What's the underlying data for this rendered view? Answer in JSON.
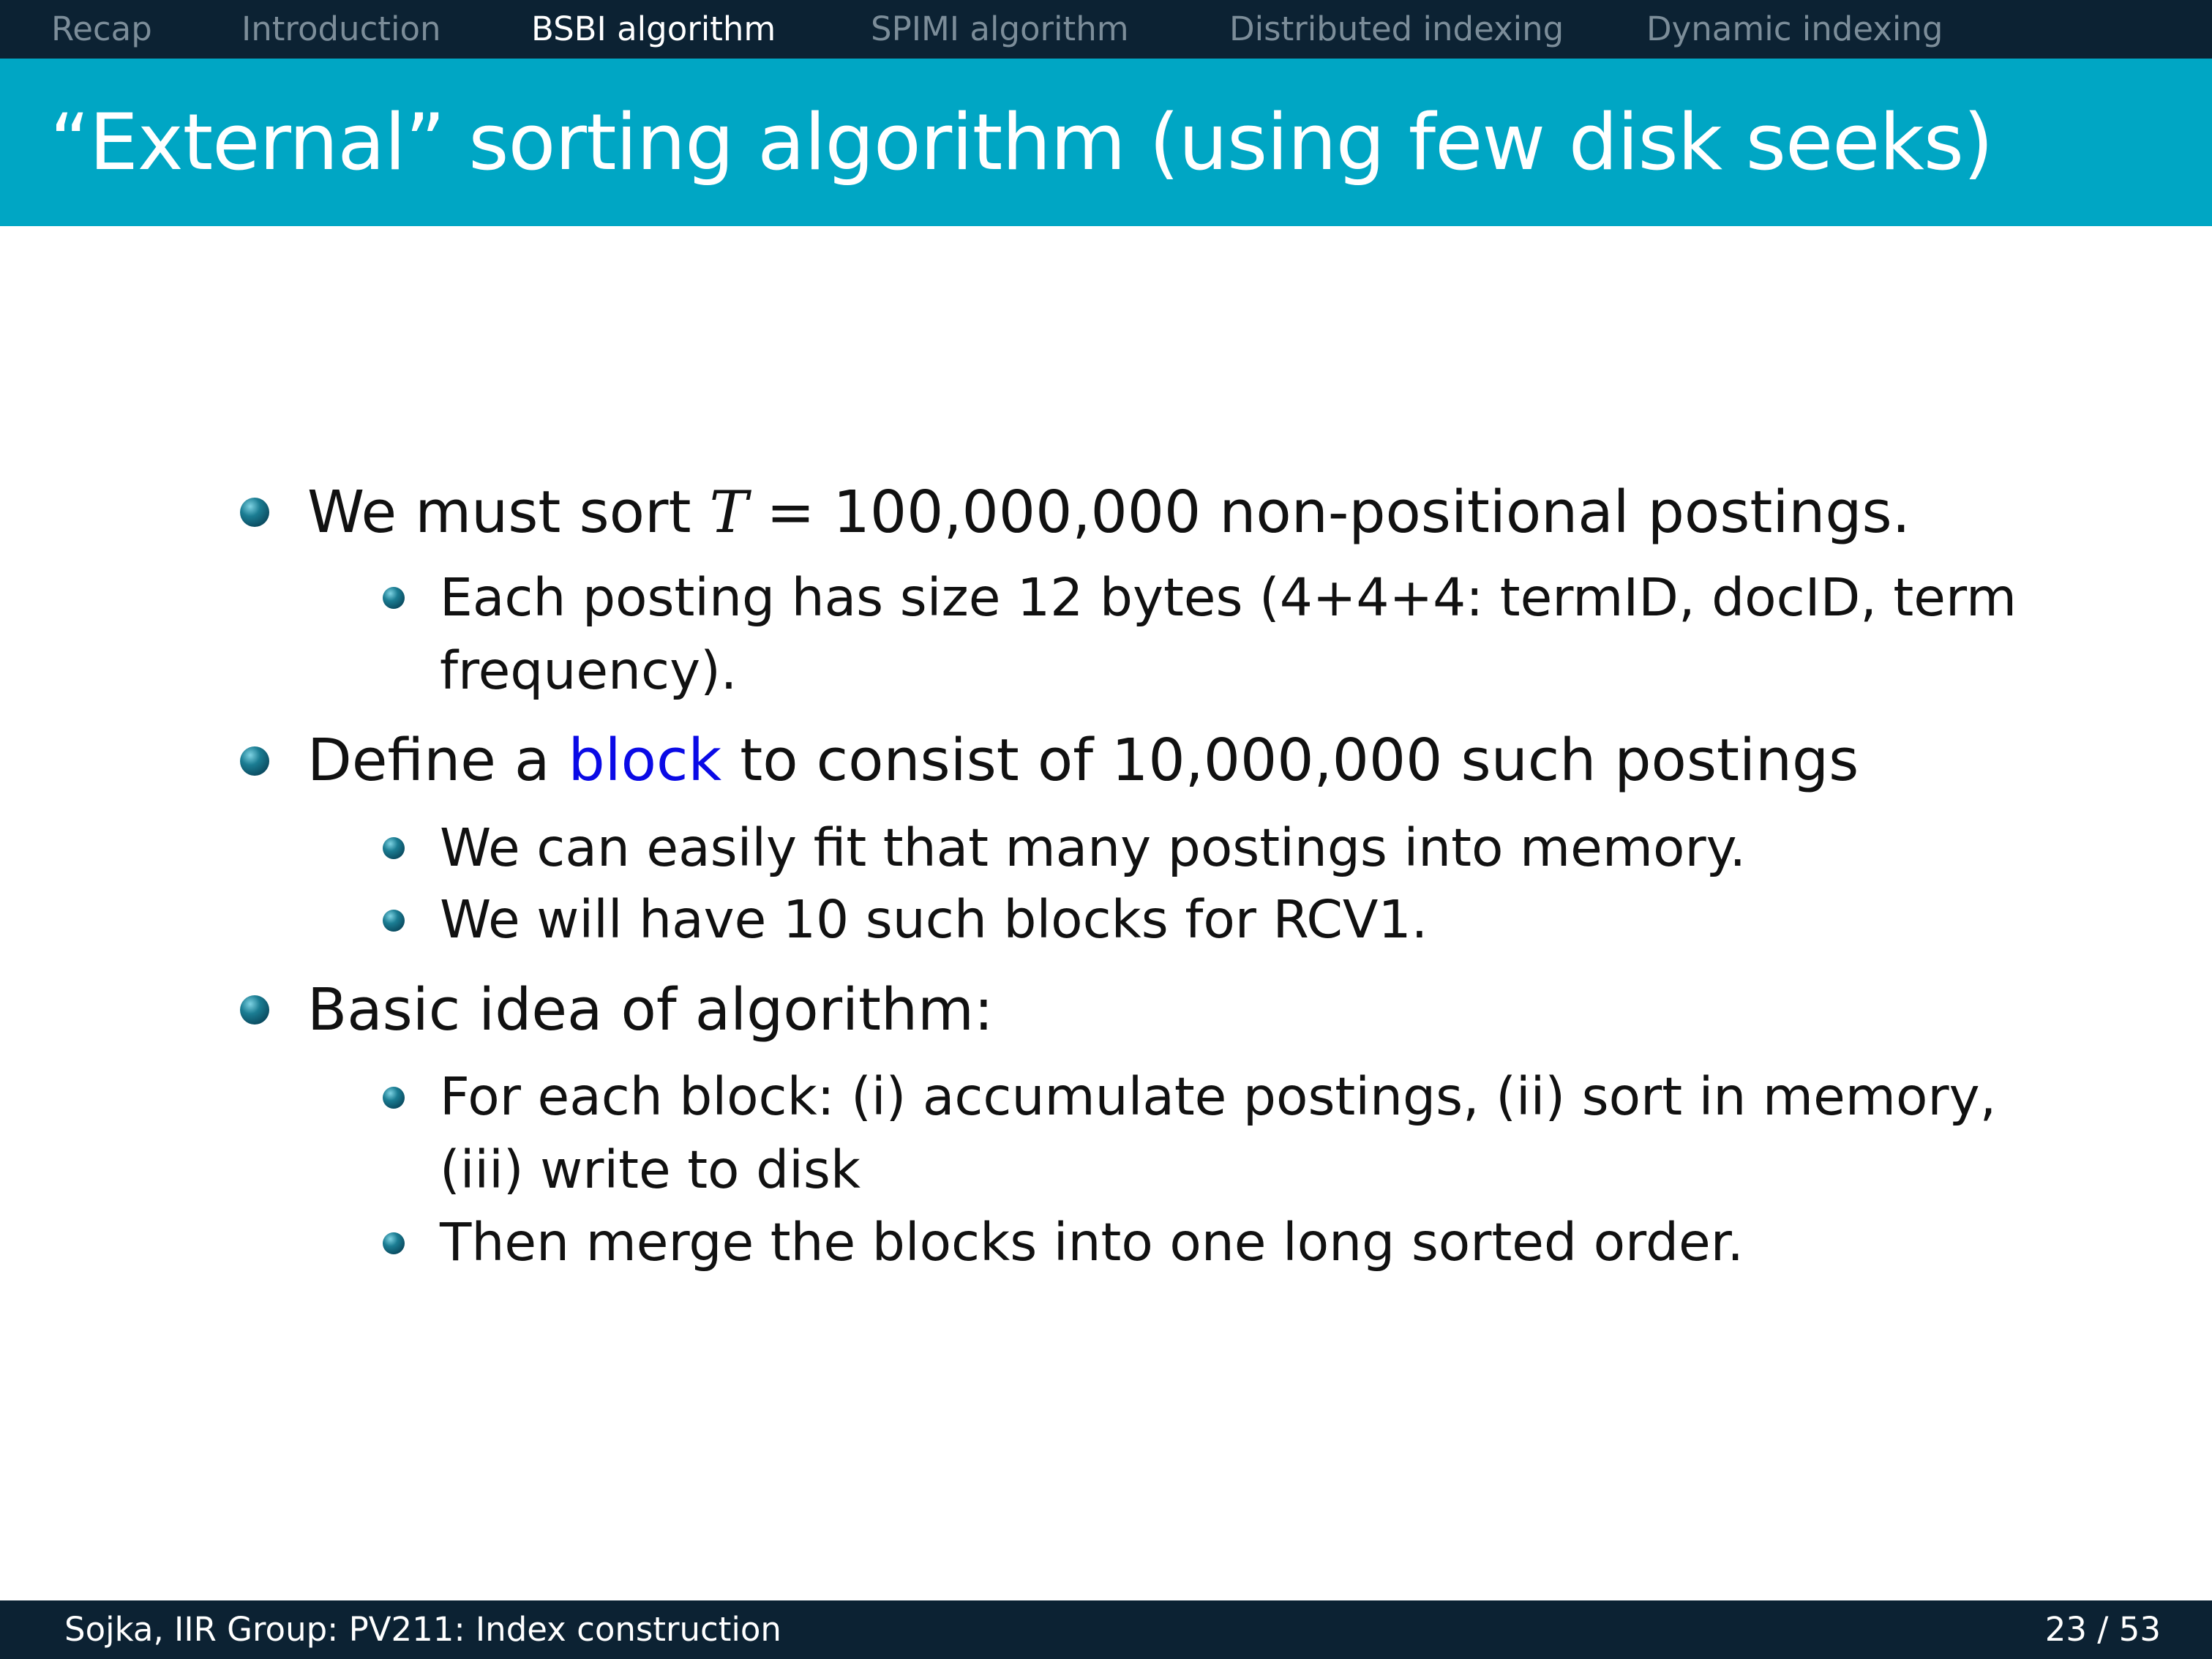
{
  "nav": {
    "items": [
      {
        "label": "Recap"
      },
      {
        "label": "Introduction"
      },
      {
        "label": "BSBI algorithm"
      },
      {
        "label": "SPIMI algorithm"
      },
      {
        "label": "Distributed indexing"
      },
      {
        "label": "Dynamic indexing"
      }
    ],
    "active_index": 2
  },
  "slide": {
    "title": "“External” sorting algorithm (using few disk seeks)",
    "bullets": [
      {
        "text_before": "We must sort ",
        "math_var": "T",
        "text_after": " = 100,000,000 non-positional postings.",
        "sub": [
          {
            "lines": [
              "Each posting has size 12 bytes (4+4+4: termID, docID, term",
              "frequency)."
            ]
          }
        ]
      },
      {
        "text_before": "Define a ",
        "keyword": "block",
        "text_after": " to consist of 10,000,000 such postings",
        "sub": [
          {
            "lines": [
              "We can easily fit that many postings into memory."
            ]
          },
          {
            "lines": [
              "We will have 10 such blocks for RCV1."
            ]
          }
        ]
      },
      {
        "text": "Basic idea of algorithm:",
        "sub": [
          {
            "lines": [
              "For each block: (i) accumulate postings, (ii) sort in memory,",
              "(iii) write to disk"
            ]
          },
          {
            "lines": [
              "Then merge the blocks into one long sorted order."
            ]
          }
        ]
      }
    ]
  },
  "footer": {
    "left": "Sojka, IIR Group: PV211: Index construction",
    "page_current": "23",
    "page_total": "53",
    "page_sep": " / "
  },
  "colors": {
    "navbar_bg": "#0c2233",
    "titlebar_bg": "#00a6c4",
    "nav_inactive": "#7c8d99",
    "nav_active": "#ffffff",
    "keyword": "#0a0ae6"
  }
}
